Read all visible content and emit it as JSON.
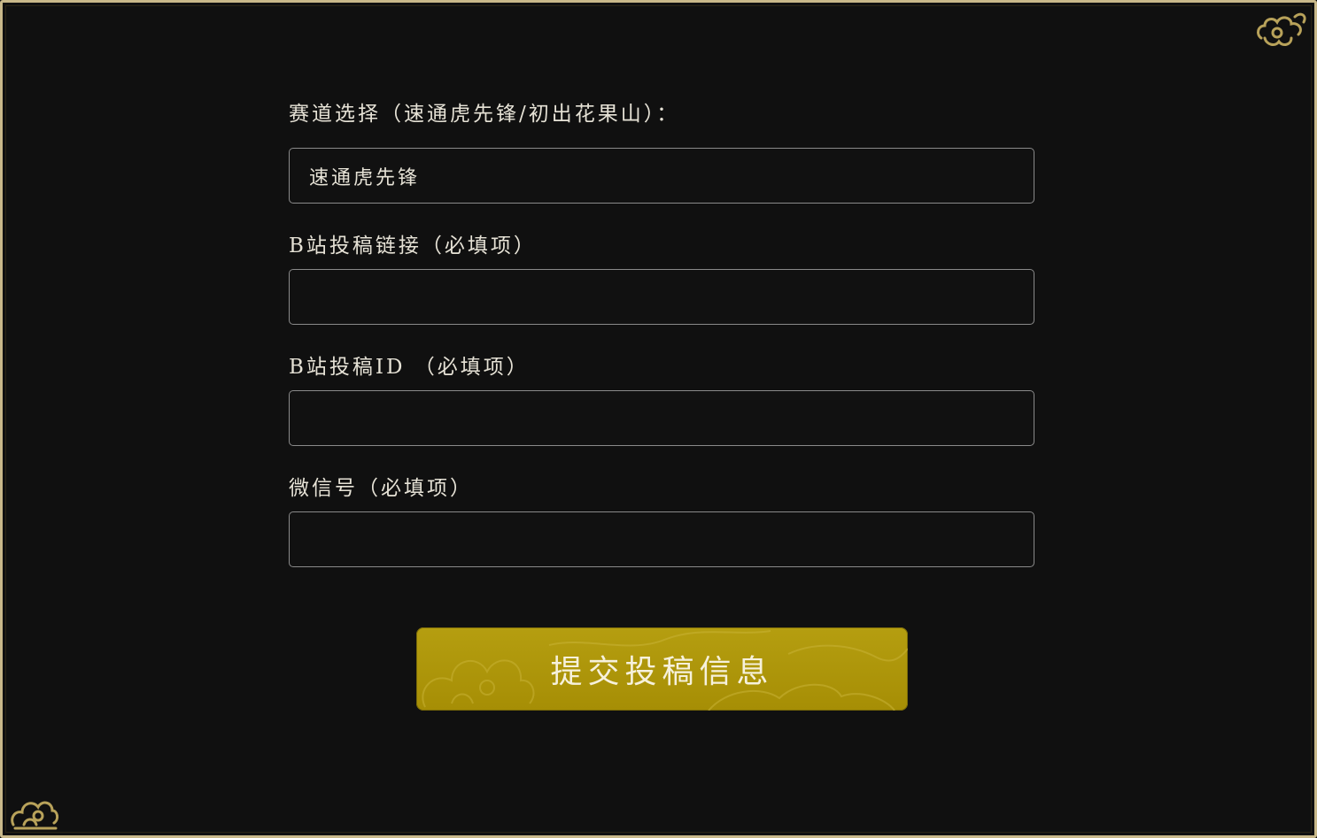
{
  "form": {
    "track": {
      "label": "赛道选择（速通虎先锋/初出花果山）：",
      "value": "速通虎先锋"
    },
    "bilibili_link": {
      "label": "B站投稿链接（必填项）",
      "value": ""
    },
    "bilibili_id": {
      "label": "B站投稿ID （必填项）",
      "value": ""
    },
    "wechat": {
      "label": "微信号（必填项）",
      "value": ""
    },
    "submit_label": "提交投稿信息"
  },
  "colors": {
    "background": "#101010",
    "frame_border": "#c9b98a",
    "button": "#b59e10",
    "text": "#e6e2d6"
  },
  "icons": [
    "cloud-ornament-icon",
    "cloud-ornament-icon"
  ]
}
